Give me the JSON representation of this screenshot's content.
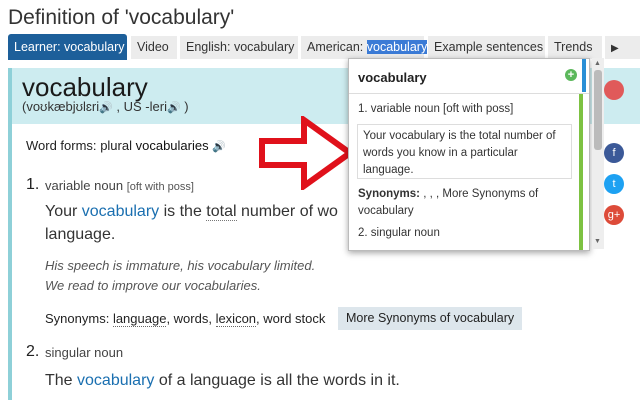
{
  "page": {
    "title": "Definition of 'vocabulary'"
  },
  "tabs": [
    {
      "label": "Learner: vocabulary"
    },
    {
      "label": "Video"
    },
    {
      "label": "English: vocabulary"
    },
    {
      "label_prefix": "American: ",
      "label_highlight": "vocabulary"
    },
    {
      "label": "Example sentences"
    },
    {
      "label": "Trends"
    }
  ],
  "entry": {
    "headword": "vocabulary",
    "pron_1": "(voʊkæbjʊlɛri",
    "pron_sep": " , US -leri",
    "pron_close": " )",
    "word_forms_label": "Word forms:",
    "word_forms_type": "plural",
    "word_forms_value": "vocabularies",
    "sense1": {
      "num": "1.",
      "pos": "variable noun",
      "grammar": "[oft with poss]",
      "def_pre": "Your ",
      "def_kw": "vocabulary",
      "def_mid": " is the ",
      "def_u": "total",
      "def_post": " number of wo",
      "def_line2": "language.",
      "ex1": "His speech is immature, his vocabulary limited.",
      "ex2": "We read to improve our vocabularies.",
      "syn_label": "Synonyms:",
      "syn1": "language",
      "syn_sep1": ", words, ",
      "syn2": "lexicon",
      "syn_sep2": ", word stock",
      "more_btn": "More Synonyms of vocabulary"
    },
    "sense2": {
      "num": "2.",
      "pos": "singular noun",
      "def_pre": "The ",
      "def_kw": "vocabulary",
      "def_post": " of a language is all the words in it."
    }
  },
  "popup": {
    "word": "vocabulary",
    "sense1": "1. variable noun [oft with poss]",
    "def": "Your vocabulary is the total number of words you know in a particular language.",
    "syn_label": "Synonyms:",
    "syn_value": " , , ,   More Synonyms of vocabulary",
    "sense2": "2. singular noun"
  },
  "colors": {
    "accent": "#1d5f9a",
    "link": "#1a6fb0",
    "header_bg": "#cdecf0",
    "arrow": "#e0111b"
  },
  "icons": [
    "speaker-icon",
    "arrow-icon",
    "plus-icon",
    "facebook-icon",
    "twitter-icon",
    "google-plus-icon"
  ]
}
